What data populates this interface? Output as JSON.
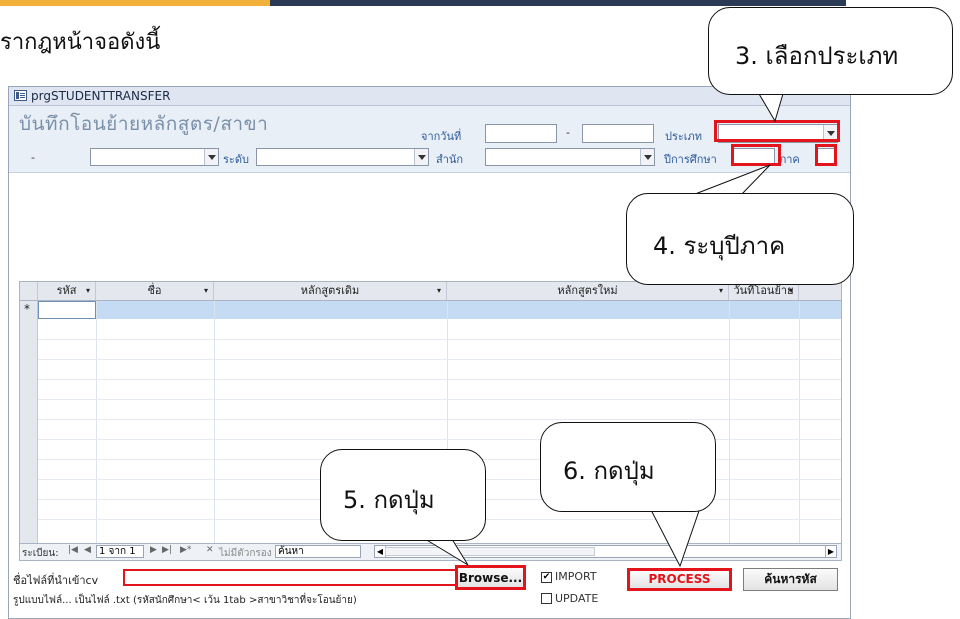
{
  "doc": {
    "intro_text": "รากฎหน้าจอดังนี้"
  },
  "window": {
    "title": "prgSTUDENTTRANSFER"
  },
  "form": {
    "title": "บันทึกโอนย้ายหลักสูตร/สาขา",
    "from_date_label": "จากวันที่",
    "from_date_value": "",
    "date_separator": "-",
    "to_date_value": "",
    "type_label": "ประเภท",
    "type_value": "",
    "left_dash": "-",
    "level_label": "ระดับ",
    "office_label": "สำนัก",
    "year_label": "ปีการศึกษา",
    "year_value": "",
    "semester_label": "ภาค",
    "semester_value": ""
  },
  "grid": {
    "columns": [
      {
        "label": "รหัส"
      },
      {
        "label": "ชื่อ"
      },
      {
        "label": "หลักสูตรเดิม"
      },
      {
        "label": "หลักสูตรใหม่"
      },
      {
        "label": "วันที่โอนย้าย"
      }
    ],
    "new_record_marker": "*"
  },
  "navigation": {
    "record_label": "ระเบียน:",
    "record_position": "1 จาก 1",
    "filter_label": "ไม่มีตัวกรอง",
    "search_placeholder": "ค้นหา"
  },
  "import": {
    "file_label": "ชื่อไฟล์ที่นำเข้าcv",
    "file_value": "",
    "browse_label": "Browse...",
    "format_note": "รูปแบบไฟล์... เป็นไฟล์ .txt  (รหัสนักศึกษา< เว้น 1tab >สาขาวิชาที่จะโอนย้าย)",
    "import_option": "IMPORT",
    "import_checked": true,
    "update_option": "UPDATE",
    "update_checked": false,
    "process_label": "PROCESS",
    "search_code_label": "ค้นหารหัส"
  },
  "callouts": {
    "step3": "3.  เลือกประเภท",
    "step4": "4.  ระบุปีภาค",
    "step5": "5.  กดปุ่ม",
    "step6": "6.  กดปุ่ม"
  },
  "colors": {
    "highlight_red": "#e3141b",
    "process_text": "#e3141b",
    "header_bg": "#e9eff7",
    "label_blue": "#2d5a9b",
    "new_row_blue": "#c5daf3"
  }
}
